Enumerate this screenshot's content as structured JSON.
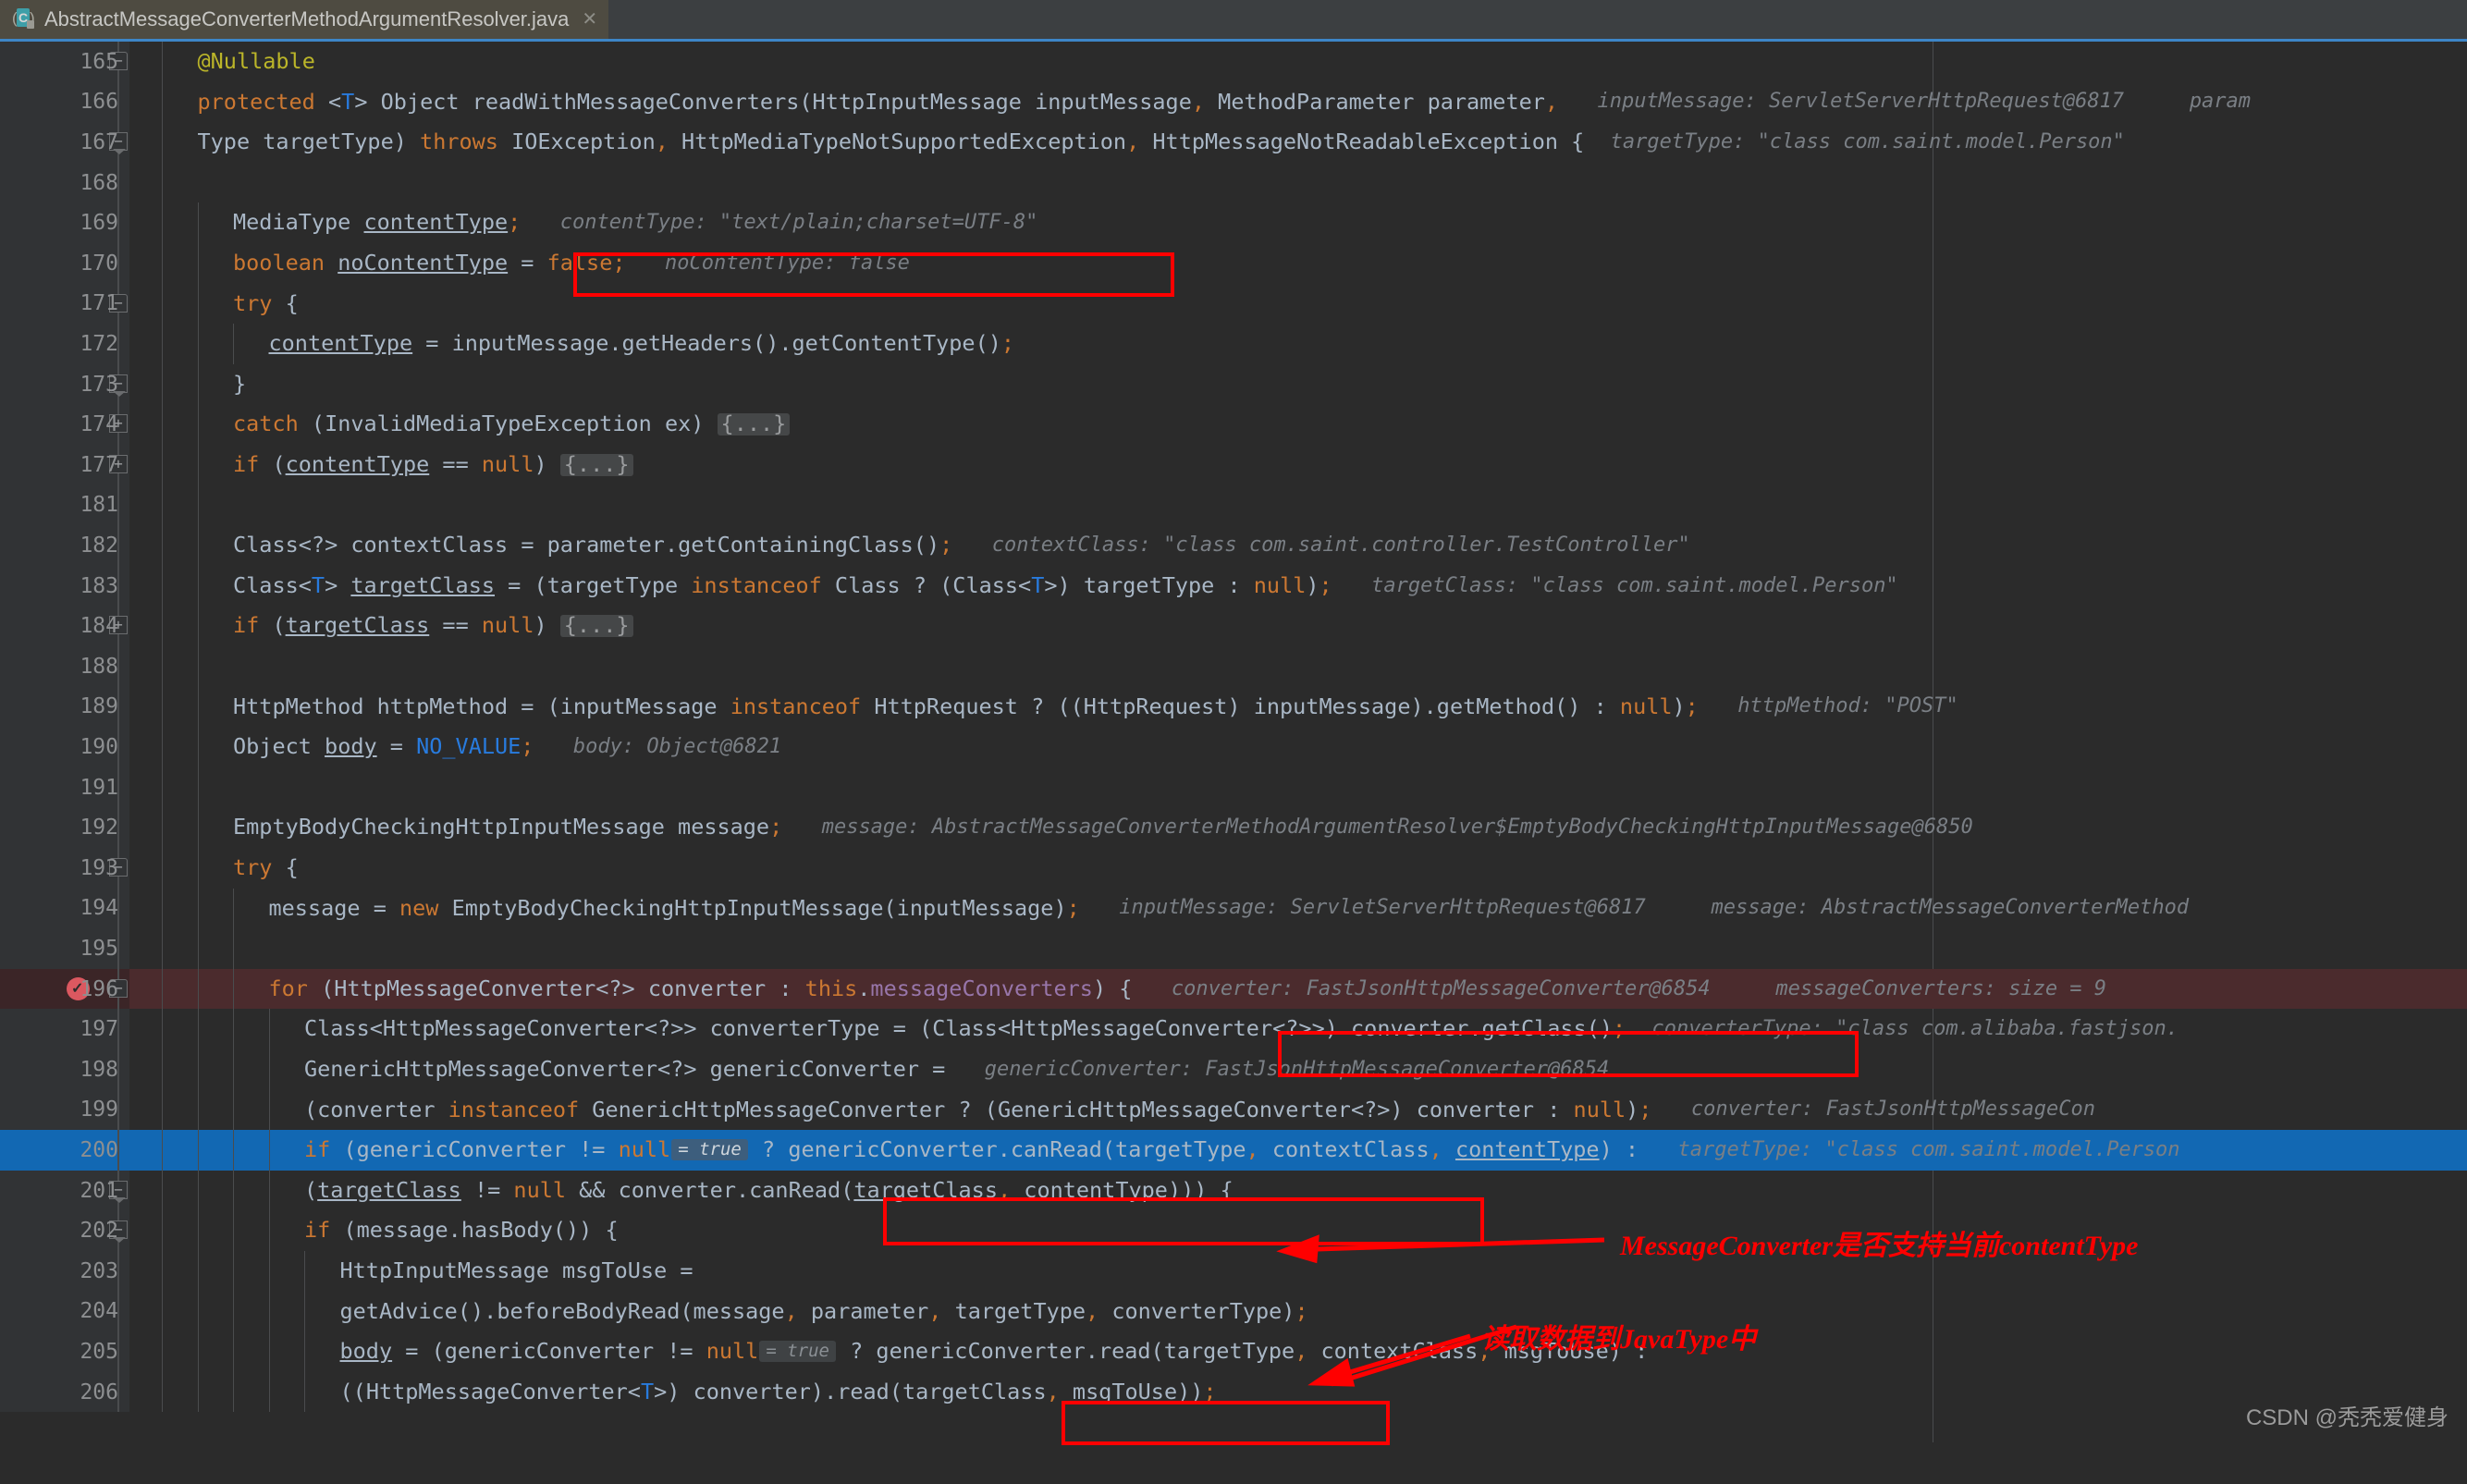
{
  "window": {
    "tab": {
      "title": "AbstractMessageConverterMethodArgumentResolver.java",
      "icon": "java-class-icon",
      "close_label": "✕"
    },
    "accent_color": "#3d86c7",
    "background": "#2b2b2b"
  },
  "editor": {
    "selected_line": 200,
    "breakpoint_line": 196,
    "lines": [
      {
        "no": "165",
        "fold": "start",
        "indent": 1
      },
      {
        "no": "166",
        "fold": "none",
        "indent": 1
      },
      {
        "no": "167",
        "fold": "arrow",
        "indent": 1
      },
      {
        "no": "168",
        "fold": "none",
        "indent": 1
      },
      {
        "no": "169",
        "fold": "none",
        "indent": 2
      },
      {
        "no": "170",
        "fold": "none",
        "indent": 2
      },
      {
        "no": "171",
        "fold": "start",
        "indent": 2
      },
      {
        "no": "172",
        "fold": "none",
        "indent": 3
      },
      {
        "no": "173",
        "fold": "arrow",
        "indent": 2
      },
      {
        "no": "174",
        "fold": "plus",
        "indent": 2
      },
      {
        "no": "177",
        "fold": "plus",
        "indent": 2
      },
      {
        "no": "181",
        "fold": "none",
        "indent": 2
      },
      {
        "no": "182",
        "fold": "none",
        "indent": 2
      },
      {
        "no": "183",
        "fold": "none",
        "indent": 2
      },
      {
        "no": "184",
        "fold": "plus",
        "indent": 2
      },
      {
        "no": "188",
        "fold": "none",
        "indent": 2
      },
      {
        "no": "189",
        "fold": "none",
        "indent": 2
      },
      {
        "no": "190",
        "fold": "none",
        "indent": 2
      },
      {
        "no": "191",
        "fold": "none",
        "indent": 2
      },
      {
        "no": "192",
        "fold": "none",
        "indent": 2
      },
      {
        "no": "193",
        "fold": "start",
        "indent": 2
      },
      {
        "no": "194",
        "fold": "none",
        "indent": 3
      },
      {
        "no": "195",
        "fold": "none",
        "indent": 3
      },
      {
        "no": "196",
        "fold": "start",
        "indent": 3
      },
      {
        "no": "197",
        "fold": "none",
        "indent": 4
      },
      {
        "no": "198",
        "fold": "none",
        "indent": 4
      },
      {
        "no": "199",
        "fold": "none",
        "indent": 4
      },
      {
        "no": "200",
        "fold": "none",
        "indent": 4
      },
      {
        "no": "201",
        "fold": "arrow",
        "indent": 4
      },
      {
        "no": "202",
        "fold": "arrow",
        "indent": 4
      },
      {
        "no": "203",
        "fold": "none",
        "indent": 5
      },
      {
        "no": "204",
        "fold": "none",
        "indent": 5
      },
      {
        "no": "205",
        "fold": "none",
        "indent": 5
      },
      {
        "no": "206",
        "fold": "none",
        "indent": 5
      }
    ],
    "code": {
      "l165": "@Nullable",
      "l166_code": "protected <T> Object readWithMessageConverters(HttpInputMessage inputMessage, MethodParameter parameter,",
      "l166_hint1": "inputMessage:  ServletServerHttpRequest@6817",
      "l166_hint2": "param",
      "l167_code": "Type targetType) throws IOException, HttpMediaTypeNotSupportedException, HttpMessageNotReadableException {",
      "l167_hint": "targetType:  \"class com.saint.model.Person\"",
      "l169_code": "MediaType contentType;",
      "l169_hint": "contentType:  \"text/plain;charset=UTF-8\"",
      "l170_code": "boolean noContentType = false;",
      "l170_hint": "noContentType: false",
      "l171_code": "try {",
      "l172_code": "contentType = inputMessage.getHeaders().getContentType();",
      "l173_code": "}",
      "l174_code": "catch (InvalidMediaTypeException ex) {...}",
      "l177_code": "if (contentType == null) {...}",
      "l182_code": "Class<?> contextClass = parameter.getContainingClass();",
      "l182_hint": "contextClass:  \"class com.saint.controller.TestController\"",
      "l183_code": "Class<T> targetClass = (targetType instanceof Class ? (Class<T>) targetType : null);",
      "l183_hint": "targetClass:  \"class com.saint.model.Person\"",
      "l184_code": "if (targetClass == null) {...}",
      "l189_code": "HttpMethod httpMethod = (inputMessage instanceof HttpRequest ? ((HttpRequest) inputMessage).getMethod() : null);",
      "l189_hint": "httpMethod:  \"POST\"",
      "l190_code": "Object body = NO_VALUE;",
      "l190_hint": "body: Object@6821",
      "l192_code": "EmptyBodyCheckingHttpInputMessage message;",
      "l192_hint": "message: AbstractMessageConverterMethodArgumentResolver$EmptyBodyCheckingHttpInputMessage@6850",
      "l193_code": "try {",
      "l194_code": "message = new EmptyBodyCheckingHttpInputMessage(inputMessage);",
      "l194_hint1": "inputMessage:  ServletServerHttpRequest@6817",
      "l194_hint2": "message: AbstractMessageConverterMethod",
      "l196_code": "for (HttpMessageConverter<?> converter : this.messageConverters) {",
      "l196_hint1": "converter: FastJsonHttpMessageConverter@6854",
      "l196_hint2": "messageConverters:  size = 9",
      "l197_code": "Class<HttpMessageConverter<?>> converterType = (Class<HttpMessageConverter<?>>) converter.getClass();",
      "l197_hint": "converterType: \"class com.alibaba.fastjson.",
      "l198_code": "GenericHttpMessageConverter<?> genericConverter =",
      "l198_hint": "genericConverter: FastJsonHttpMessageConverter@6854",
      "l199_code": "(converter instanceof GenericHttpMessageConverter ? (GenericHttpMessageConverter<?>) converter : null);",
      "l199_hint": "converter: FastJsonHttpMessageCon",
      "l200_code_a": "if (genericConverter != null",
      "l200_tag": "= true",
      "l200_code_b": "? genericConverter.canRead(targetType, contextClass, contentType) :",
      "l200_hint": "targetType: \"class com.saint.model.Person",
      "l201_code": "(targetClass != null && converter.canRead(targetClass, contentType))) {",
      "l202_code": "if (message.hasBody()) {",
      "l203_code": "HttpInputMessage msgToUse =",
      "l204_code": "getAdvice().beforeBodyRead(message, parameter, targetType, converterType);",
      "l205_code_a": "body = (genericConverter != null",
      "l205_tag": "= true",
      "l205_code_b": "? genericConverter.read(targetType, contextClass, msgToUse) :",
      "l206_code": "((HttpMessageConverter<T>) converter).read(targetClass, msgToUse));"
    }
  },
  "annotations": {
    "color": "#ff0000",
    "note_1": "MessageConverter是否支持当前contentType",
    "note_2": "读取数据到JavaType中",
    "boxes": [
      {
        "name": "contenttype-hint-box"
      },
      {
        "name": "converter-hint-box"
      },
      {
        "name": "canread-call-box"
      },
      {
        "name": "read-call-box"
      }
    ]
  },
  "watermark": "CSDN @秃秃爱健身"
}
